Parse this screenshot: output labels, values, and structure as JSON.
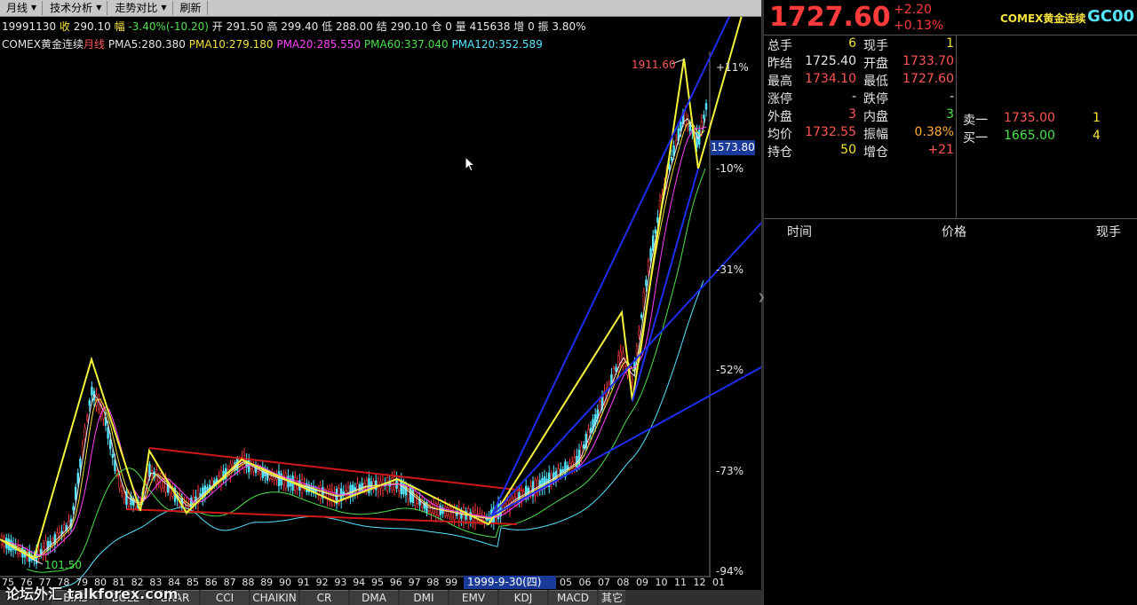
{
  "toolbar": {
    "items": [
      {
        "label": "月线",
        "has_arrow": true
      },
      {
        "label": "技术分析",
        "has_arrow": true
      },
      {
        "label": "走势对比",
        "has_arrow": true
      },
      {
        "label": "刷新",
        "has_arrow": false
      }
    ]
  },
  "info_line": {
    "date": "19991130",
    "close_label": "收",
    "close": "290.10",
    "range_label": "幅",
    "range": "-3.40%(-10.20)",
    "open_label": "开",
    "open": "291.50",
    "high_label": "高",
    "high": "299.40",
    "low_label": "低",
    "low": "288.00",
    "settle_label": "结",
    "settle": "290.10",
    "oi_label": "仓",
    "oi": "0",
    "vol_label": "量",
    "vol": "415638",
    "incr_label": "增",
    "incr": "0",
    "amp_label": "振",
    "amp": "3.80%"
  },
  "ma_line": {
    "symbol": "COMEX黄金连续",
    "period": "月线",
    "pma5": "PMA5:280.380",
    "pma10": "PMA10:279.180",
    "pma20": "PMA20:285.550",
    "pma60": "PMA60:337.040",
    "pma120": "PMA120:352.589"
  },
  "chart": {
    "y_pct_labels": [
      "+11%",
      "-10%",
      "-31%",
      "-52%",
      "-73%",
      "-94%"
    ],
    "last_price_tag": "1573.80",
    "high_annotation": "1911.60",
    "low_annotation": "101.50",
    "date_tip": "1999-9-30(四)",
    "x_labels": [
      "75",
      "76",
      "77",
      "78",
      "79",
      "80",
      "81",
      "82",
      "83",
      "84",
      "85",
      "86",
      "87",
      "88",
      "89",
      "90",
      "91",
      "92",
      "93",
      "94",
      "95",
      "96",
      "97",
      "98",
      "99",
      "05",
      "06",
      "07",
      "08",
      "09",
      "10",
      "11",
      "12",
      "01"
    ],
    "colors": {
      "up": "#ff3b3b",
      "down": "#55e6ff",
      "trend_yellow": "#f5f53c",
      "trend_blue": "#1e2ef0",
      "channel_red": "#d01818"
    }
  },
  "bottom_tabs": [
    "BIAS",
    "BOLL",
    "BRAR",
    "CCI",
    "CHAIKIN",
    "CR",
    "DMA",
    "DMI",
    "EMV",
    "KDJ",
    "MACD",
    "其它"
  ],
  "watermark": "论坛外汇 talkforex.com",
  "quote": {
    "price": "1727.60",
    "change": "+2.20",
    "change_pct": "+0.13%",
    "name": "COMEX黄金连续",
    "code": "GC00",
    "rows": [
      {
        "l1": "总手",
        "v1": "6",
        "l2": "现手",
        "v2": "1"
      },
      {
        "l1": "昨结",
        "v1": "1725.40",
        "l2": "开盘",
        "v2": "1733.70"
      },
      {
        "l1": "最高",
        "v1": "1734.10",
        "l2": "最低",
        "v2": "1727.60"
      },
      {
        "l1": "涨停",
        "v1": "-",
        "l2": "跌停",
        "v2": "-"
      },
      {
        "l1": "外盘",
        "v1": "3",
        "l2": "内盘",
        "v2": "3"
      },
      {
        "l1": "均价",
        "v1": "1732.55",
        "l2": "振幅",
        "v2": "0.38%"
      },
      {
        "l1": "持仓",
        "v1": "50",
        "l2": "增仓",
        "v2": "+21"
      }
    ],
    "ask": {
      "label": "卖一",
      "price": "1735.00",
      "vol": "1"
    },
    "bid": {
      "label": "买一",
      "price": "1665.00",
      "vol": "4"
    }
  },
  "ticks": {
    "col_time": "时间",
    "col_price": "价格",
    "col_vol": "现手"
  }
}
